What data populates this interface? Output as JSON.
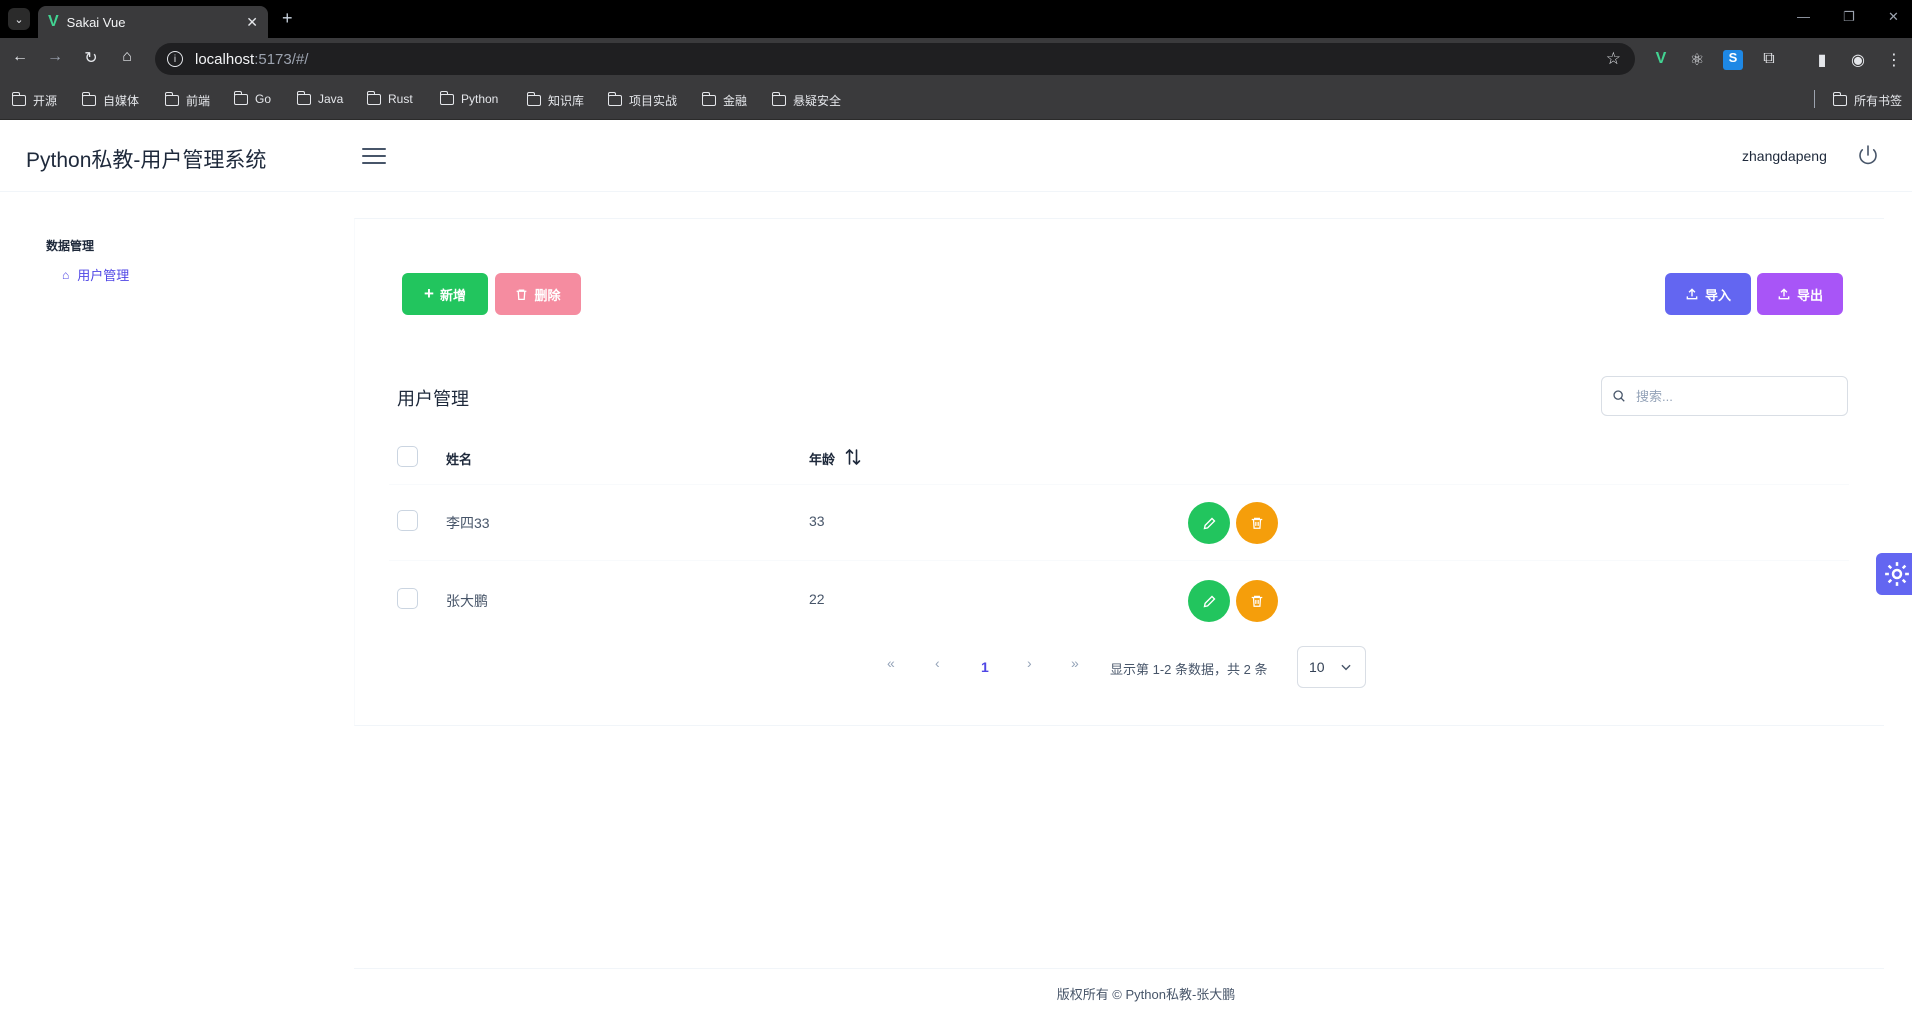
{
  "browser": {
    "tab_title": "Sakai Vue",
    "tab_close": "✕",
    "new_tab": "+",
    "url_host": "localhost",
    "url_path": ":5173/#/",
    "bookmarks": [
      "开源",
      "自媒体",
      "前端",
      "Go",
      "Java",
      "Rust",
      "Python",
      "知识库",
      "项目实战",
      "金融",
      "悬疑安全"
    ],
    "all_bookmarks": "所有书签"
  },
  "app": {
    "title": "Python私教-用户管理系统",
    "username": "zhangdapeng"
  },
  "sidebar": {
    "group": "数据管理",
    "items": [
      {
        "label": "用户管理"
      }
    ]
  },
  "toolbar": {
    "new_label": "新增",
    "delete_label": "删除",
    "import_label": "导入",
    "export_label": "导出"
  },
  "table": {
    "title": "用户管理",
    "search_placeholder": "搜索...",
    "columns": {
      "name": "姓名",
      "age": "年龄"
    },
    "rows": [
      {
        "name": "李四33",
        "age": "33"
      },
      {
        "name": "张大鹏",
        "age": "22"
      }
    ]
  },
  "pagination": {
    "first": "«",
    "prev": "‹",
    "current_page": "1",
    "next": "›",
    "last": "»",
    "summary": "显示第 1-2 条数据，共 2 条",
    "rows_per_page": "10"
  },
  "footer": {
    "copyright": "版权所有 © Python私教-张大鹏"
  },
  "colors": {
    "primary": "#6366f1",
    "success": "#22c55e",
    "danger_soft": "#f58ca0",
    "warning": "#f59e0b",
    "help": "#a855f7"
  }
}
